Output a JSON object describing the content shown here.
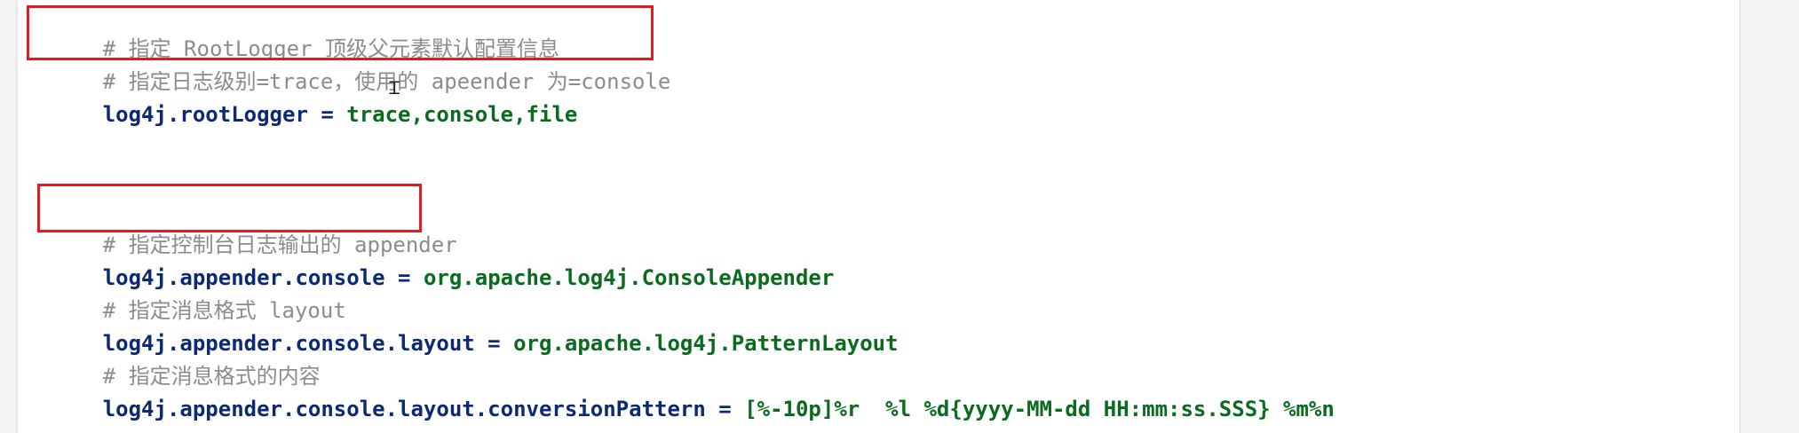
{
  "editor": {
    "lines": [
      {
        "type": "comment",
        "text": "# 指定 RootLogger 顶级父元素默认配置信息"
      },
      {
        "type": "comment",
        "text": "# 指定日志级别=trace，使用的 apeender 为=console"
      },
      {
        "type": "prop",
        "key": "log4j.rootLogger",
        "eq": " = ",
        "value": "trace,console,file"
      },
      {
        "type": "comment",
        "text": "# 指定控制台日志输出的 appender"
      },
      {
        "type": "prop",
        "key": "log4j.appender.console",
        "eq": " = ",
        "value": "org.apache.log4j.ConsoleAppender"
      },
      {
        "type": "comment",
        "text": "# 指定消息格式 layout"
      },
      {
        "type": "prop",
        "key": "log4j.appender.console.layout",
        "eq": " = ",
        "value": "org.apache.log4j.PatternLayout"
      },
      {
        "type": "comment",
        "text": "# 指定消息格式的内容"
      },
      {
        "type": "prop",
        "key": "log4j.appender.console.layout.conversionPattern",
        "eq": " = ",
        "value": "[%-10p]%r  %l %d{yyyy-MM-dd HH:mm:ss.SSS} %m%n"
      }
    ]
  },
  "highlight_color": "#e01b24",
  "cursor_icon": "text-cursor-icon"
}
